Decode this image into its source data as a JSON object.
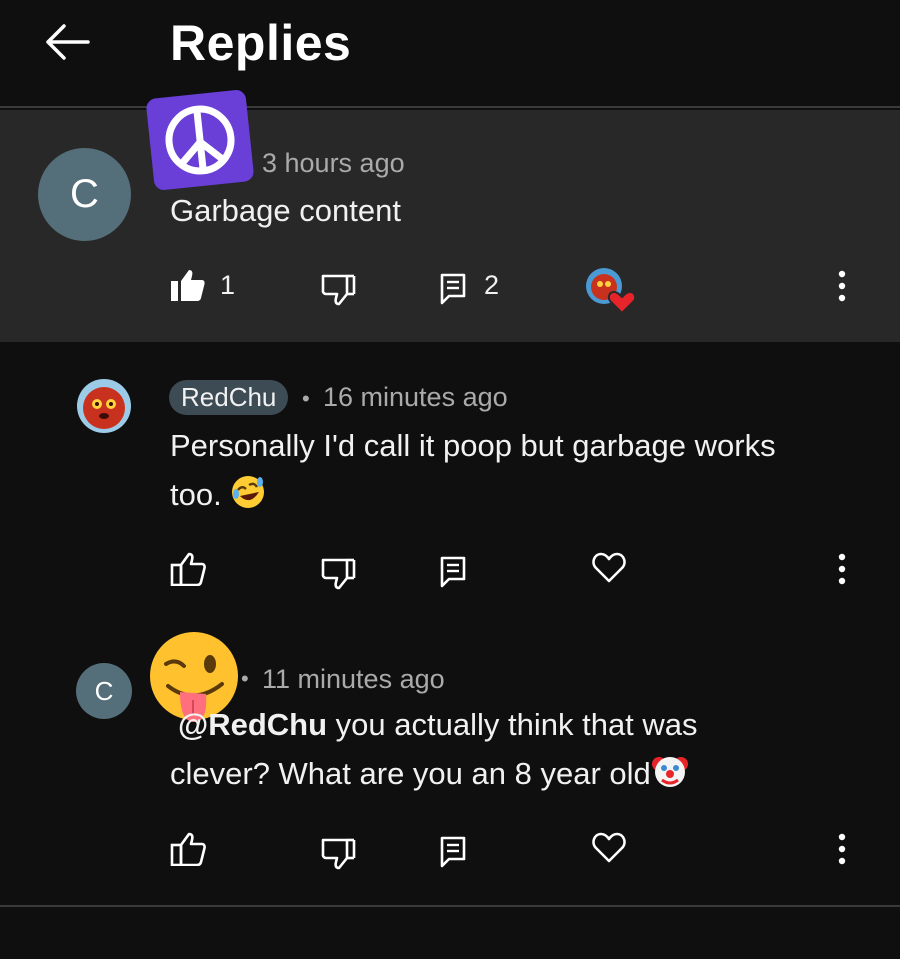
{
  "header": {
    "title": "Replies",
    "back_icon": "arrow-left-icon"
  },
  "parent_comment": {
    "avatar_letter": "C",
    "badge_icon": "peace-sign-icon",
    "timestamp": "3 hours ago",
    "text": "Garbage content",
    "like_count": "1",
    "reply_count": "2",
    "creator_heart_icon": "creator-heart-icon"
  },
  "replies": [
    {
      "author": "RedChu",
      "separator": "•",
      "timestamp": "16 minutes ago",
      "text_line1": "Personally I'd call it poop but garbage works",
      "text_line2": "too.",
      "emoji": "🤣"
    },
    {
      "avatar_letter": "C",
      "separator": "•",
      "timestamp": "11 minutes ago",
      "mention": "@RedChu",
      "text_line1": " you actually think that was",
      "text_line2": "clever? What are you an 8 year old",
      "emoji": "🤡",
      "sticker_emoji": "😜"
    }
  ],
  "colors": {
    "background": "#0f0f0f",
    "highlight": "#282828",
    "avatar": "#546e7a",
    "heart": "#e8242b",
    "badge": "#6a3fd8"
  }
}
